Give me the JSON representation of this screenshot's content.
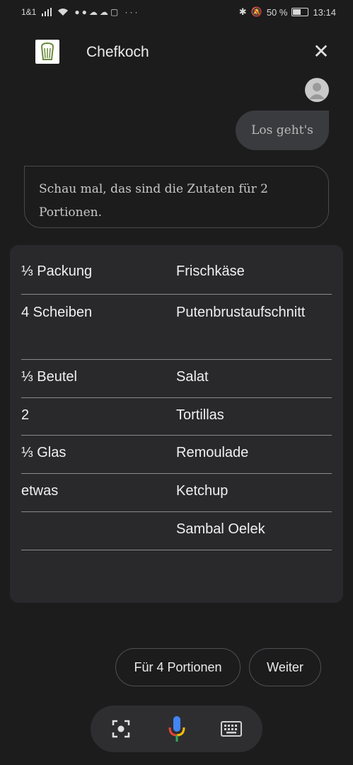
{
  "status_bar": {
    "carrier": "1&1",
    "battery": "50 %",
    "time": "13:14"
  },
  "header": {
    "title": "Chefkoch",
    "close_icon": "close-icon",
    "logo_icon": "chefkoch-hat-logo"
  },
  "chat": {
    "user_message": "Los geht's",
    "bot_message_line1": "Schau mal, das sind die Zutaten für 2",
    "bot_message_line2": "Portionen."
  },
  "ingredients": [
    {
      "qty": "⅓ Packung",
      "name": "Frischkäse"
    },
    {
      "qty": "4  Scheiben",
      "name": "Putenbrustaufschnitt"
    },
    {
      "qty": "⅓ Beutel",
      "name": "Salat"
    },
    {
      "qty": "2",
      "name": "Tortillas"
    },
    {
      "qty": "⅓ Glas",
      "name": "Remoulade"
    },
    {
      "qty": "etwas",
      "name": "Ketchup"
    },
    {
      "qty": "",
      "name": "Sambal Oelek"
    }
  ],
  "suggestions": {
    "portions_label": "Für 4 Portionen",
    "next_label": "Weiter"
  },
  "assistant_bar": {
    "icons": [
      "lens-icon",
      "microphone-icon",
      "keyboard-icon"
    ],
    "mic_colors": [
      "#4285f4",
      "#ea4335",
      "#fbbc05",
      "#34a853"
    ]
  }
}
